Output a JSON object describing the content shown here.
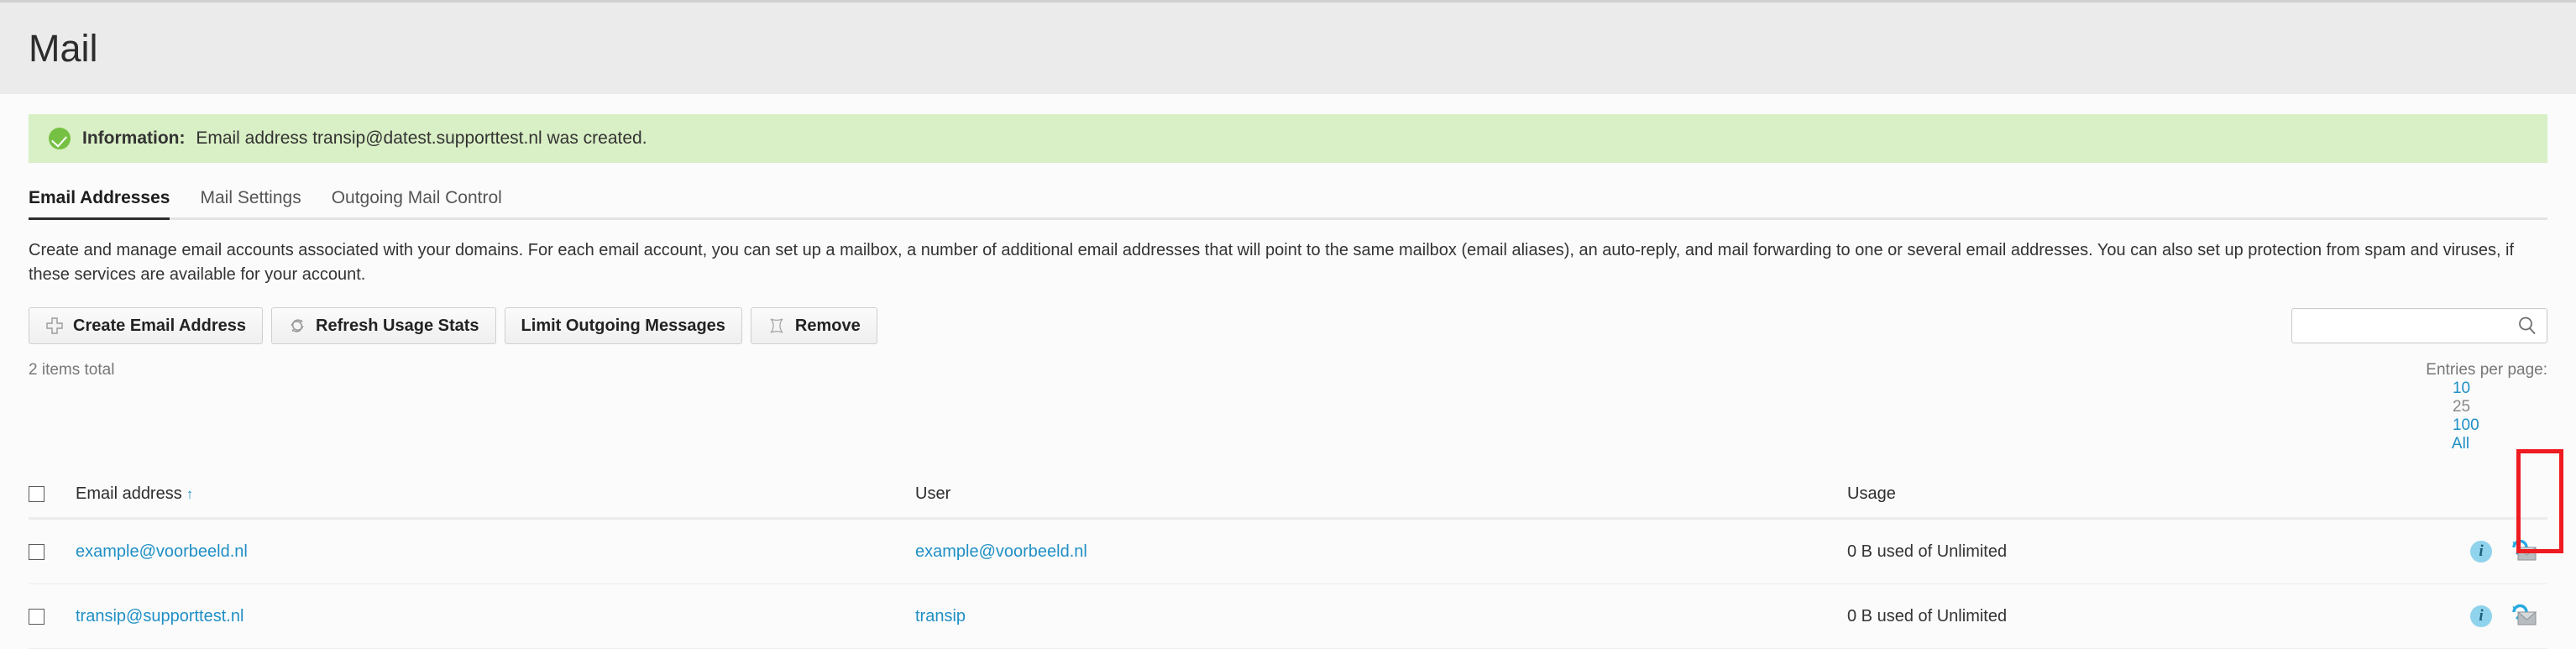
{
  "header": {
    "title": "Mail"
  },
  "banner": {
    "icon": "check-circle-icon",
    "label": "Information:",
    "text": " Email address transip@datest.supporttest.nl was created.",
    "bg_color": "#d9efc5",
    "icon_color": "#76c043"
  },
  "tabs": [
    {
      "label": "Email Addresses",
      "active": true
    },
    {
      "label": "Mail Settings",
      "active": false
    },
    {
      "label": "Outgoing Mail Control",
      "active": false
    }
  ],
  "description": "Create and manage email accounts associated with your domains. For each email account, you can set up a mailbox, a number of additional email addresses that will point to the same mailbox (email aliases), an auto-reply, and mail forwarding to one or several email addresses. You can also set up protection from spam and viruses, if these services are available for your account.",
  "toolbar": {
    "buttons": [
      {
        "label": "Create Email Address",
        "icon": "plus-icon"
      },
      {
        "label": "Refresh Usage Stats",
        "icon": "refresh-icon"
      },
      {
        "label": "Limit Outgoing Messages",
        "icon": "none"
      },
      {
        "label": "Remove",
        "icon": "remove-x-icon"
      }
    ]
  },
  "search": {
    "value": "",
    "placeholder": "",
    "icon": "search-icon"
  },
  "meta": {
    "items_total": "2 items total",
    "entries_per_page_label": "Entries per page:",
    "entries_options": [
      {
        "label": "10",
        "active": false
      },
      {
        "label": "25",
        "active": true
      },
      {
        "label": "100",
        "active": false
      },
      {
        "label": "All",
        "active": false
      }
    ]
  },
  "table": {
    "columns": {
      "email": "Email address",
      "sort_indicator": "↑",
      "user": "User",
      "usage": "Usage"
    },
    "rows": [
      {
        "email": "example@voorbeeld.nl",
        "user": "example@voorbeeld.nl",
        "usage": "0 B used of Unlimited",
        "info_icon": "info-icon",
        "webmail_icon": "webmail-envelope-icon"
      },
      {
        "email": "transip@supporttest.nl",
        "user": "transip",
        "usage": "0 B used of Unlimited",
        "info_icon": "info-icon",
        "webmail_icon": "webmail-envelope-icon"
      }
    ]
  },
  "annotation": {
    "highlight_color": "#ee1b21",
    "target": "webmail-icon-column"
  },
  "colors": {
    "link": "#1f8fc6",
    "header_bg": "#ebebeb",
    "page_bg": "#fbfbfb"
  }
}
